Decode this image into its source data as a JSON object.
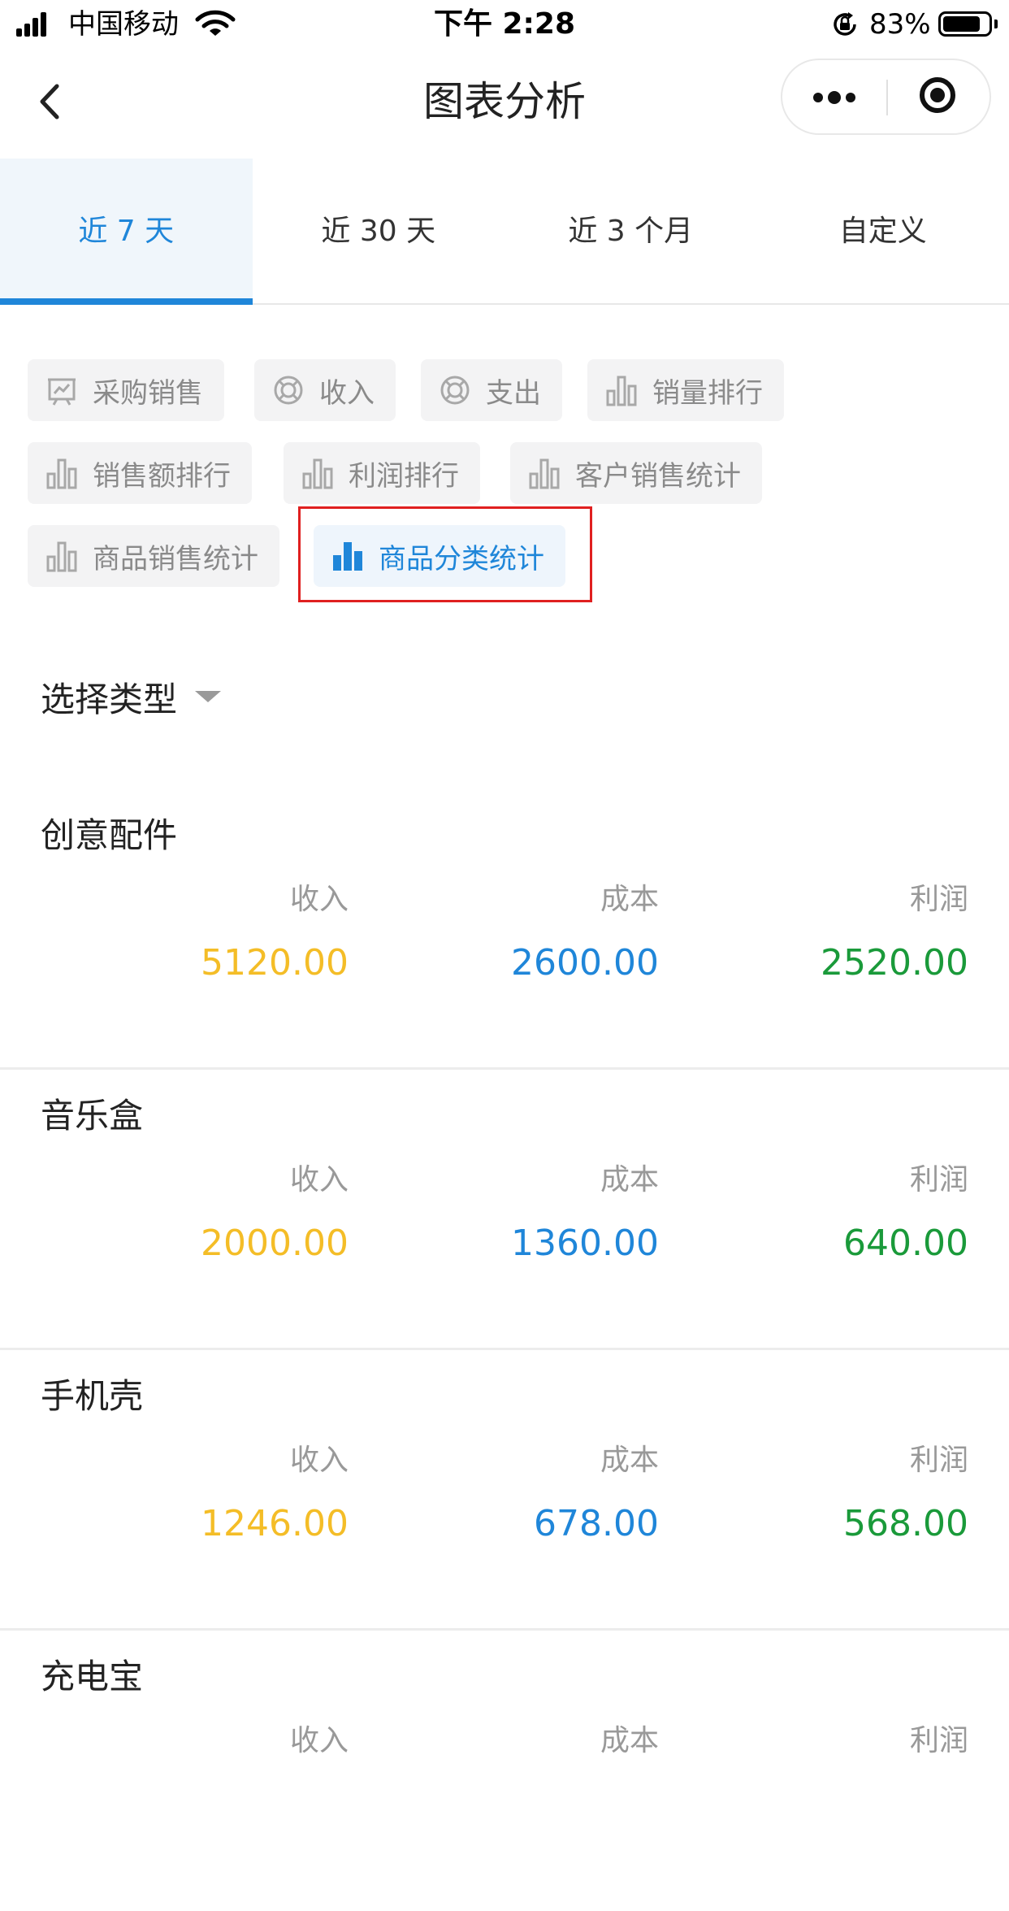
{
  "status_bar": {
    "carrier": "中国移动",
    "time": "下午 2:28",
    "battery": "83%",
    "battery_level": 0.83
  },
  "nav": {
    "title": "图表分析"
  },
  "period_tabs": [
    {
      "label": "近 7 天",
      "active": true
    },
    {
      "label": "近 30 天",
      "active": false
    },
    {
      "label": "近 3 个月",
      "active": false
    },
    {
      "label": "自定义",
      "active": false
    }
  ],
  "report_types": [
    {
      "label": "采购销售",
      "icon": "chart-board-icon"
    },
    {
      "label": "收入",
      "icon": "lifebuoy-icon"
    },
    {
      "label": "支出",
      "icon": "lifebuoy-icon"
    },
    {
      "label": "销量排行",
      "icon": "bar-chart-icon"
    },
    {
      "label": "销售额排行",
      "icon": "bar-chart-icon"
    },
    {
      "label": "利润排行",
      "icon": "bar-chart-icon"
    },
    {
      "label": "客户销售统计",
      "icon": "bar-chart-icon"
    },
    {
      "label": "商品销售统计",
      "icon": "bar-chart-icon"
    },
    {
      "label": "商品分类统计",
      "icon": "bar-chart-icon",
      "active": true
    }
  ],
  "filter": {
    "label": "选择类型"
  },
  "colors": {
    "accent": "#1f86d9",
    "income": "#f4bd27",
    "cost": "#1f86d9",
    "profit": "#1a9a3a",
    "highlight": "#e02020"
  },
  "metric_labels": {
    "income": "收入",
    "cost": "成本",
    "profit": "利润"
  },
  "categories": [
    {
      "name": "创意配件",
      "income": "5120.00",
      "cost": "2600.00",
      "profit": "2520.00"
    },
    {
      "name": "音乐盒",
      "income": "2000.00",
      "cost": "1360.00",
      "profit": "640.00"
    },
    {
      "name": "手机壳",
      "income": "1246.00",
      "cost": "678.00",
      "profit": "568.00"
    },
    {
      "name": "充电宝",
      "income": "",
      "cost": "",
      "profit": ""
    }
  ]
}
